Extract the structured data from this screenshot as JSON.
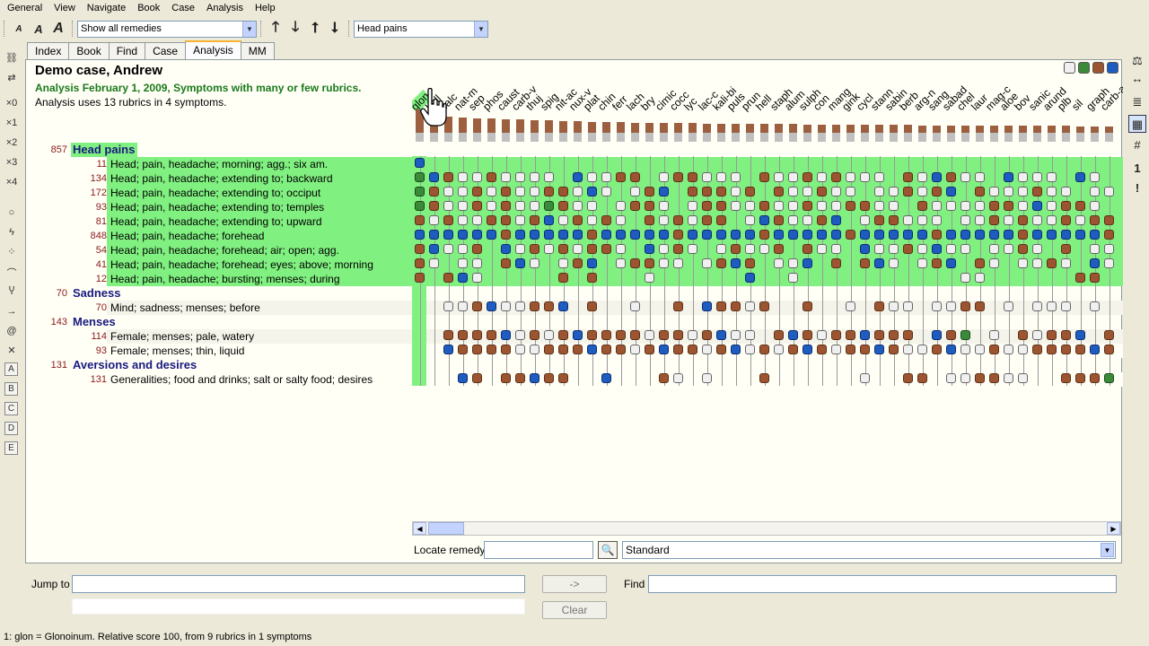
{
  "menu": [
    "General",
    "View",
    "Navigate",
    "Book",
    "Case",
    "Analysis",
    "Help"
  ],
  "toolbar": {
    "remedy_filter": "Show all remedies",
    "symptom_filter": "Head pains"
  },
  "tabs": [
    "Index",
    "Book",
    "Find",
    "Case",
    "Analysis",
    "MM"
  ],
  "active_tab": "Analysis",
  "left_icons": [
    "link-icon",
    "unlink-icon",
    "x0",
    "x1",
    "x2",
    "x3",
    "x4",
    "circle-icon",
    "lightning-icon",
    "dots-icon",
    "arc-icon",
    "fork-icon",
    "arrow-right-icon",
    "spiral-icon",
    "cross-icon",
    "A",
    "B",
    "C",
    "D",
    "E"
  ],
  "left_labels": {
    "x0": "×0",
    "x1": "×1",
    "x2": "×2",
    "x3": "×3",
    "x4": "×4"
  },
  "right_icons": [
    "scale-icon",
    "double-arrow-icon",
    "text-lines-icon",
    "grid-dark-icon",
    "grid-icon",
    "one-icon",
    "exclamation-icon"
  ],
  "case": {
    "title": "Demo case, Andrew",
    "analysis_line": "Analysis February 1, 2009, Symptoms with many or few rubrics.",
    "analysis_sub": "Analysis uses 13 rubrics in 4 symptoms."
  },
  "rows": [
    {
      "kind": "symptom",
      "count": "857",
      "label": "Head pains",
      "hl": true
    },
    {
      "kind": "rubric",
      "count": "11",
      "label": "Head; pain, headache; morning; agg.; six am.",
      "green": true
    },
    {
      "kind": "rubric",
      "count": "134",
      "label": "Head; pain, headache; extending to; backward",
      "green": true
    },
    {
      "kind": "rubric",
      "count": "172",
      "label": "Head; pain, headache; extending to; occiput",
      "green": true
    },
    {
      "kind": "rubric",
      "count": "93",
      "label": "Head; pain, headache; extending to; temples",
      "green": true
    },
    {
      "kind": "rubric",
      "count": "81",
      "label": "Head; pain, headache; extending to; upward",
      "green": true
    },
    {
      "kind": "rubric",
      "count": "848",
      "label": "Head; pain, headache; forehead",
      "green": true
    },
    {
      "kind": "rubric",
      "count": "54",
      "label": "Head; pain, headache; forehead; air; open; agg.",
      "green": true
    },
    {
      "kind": "rubric",
      "count": "41",
      "label": "Head; pain, headache; forehead; eyes; above; morning",
      "green": true
    },
    {
      "kind": "rubric",
      "count": "12",
      "label": "Head; pain, headache; bursting; menses; during",
      "green": true
    },
    {
      "kind": "symptom",
      "count": "70",
      "label": "Sadness",
      "hl": false
    },
    {
      "kind": "rubric",
      "count": "70",
      "label": "Mind; sadness; menses; before",
      "green": false
    },
    {
      "kind": "symptom",
      "count": "143",
      "label": "Menses",
      "hl": false
    },
    {
      "kind": "rubric",
      "count": "114",
      "label": "Female; menses; pale, watery",
      "green": false
    },
    {
      "kind": "rubric",
      "count": "93",
      "label": "Female; menses; thin, liquid",
      "green": false
    },
    {
      "kind": "symptom",
      "count": "131",
      "label": "Aversions and desires",
      "hl": false
    },
    {
      "kind": "rubric",
      "count": "131",
      "label": "Generalities; food and drinks; salt or salty food; desires",
      "green": false
    }
  ],
  "remedies": [
    "glon",
    "bell",
    "calc",
    "nat-m",
    "sep",
    "phos",
    "caust",
    "carb-v",
    "thuj",
    "spig",
    "nit-ac",
    "nux-v",
    "plat",
    "chin",
    "ferr",
    "lach",
    "bry",
    "cimic",
    "cocc",
    "lyc",
    "lac-c",
    "kali-bi",
    "puls",
    "prun",
    "hell",
    "staph",
    "alum",
    "sulph",
    "con",
    "mang",
    "gink",
    "cycl",
    "stann",
    "sabin",
    "berb",
    "arg-n",
    "sang",
    "sabad",
    "chel",
    "laur",
    "mag-c",
    "aloe",
    "bov",
    "sanic",
    "arund",
    "plb",
    "sil",
    "graph",
    "carb-an"
  ],
  "remedy_bars": [
    100,
    72,
    70,
    66,
    62,
    60,
    58,
    56,
    54,
    52,
    50,
    50,
    48,
    46,
    46,
    44,
    44,
    44,
    42,
    42,
    40,
    40,
    40,
    38,
    38,
    38,
    38,
    36,
    36,
    36,
    34,
    34,
    34,
    34,
    34,
    32,
    32,
    32,
    32,
    32,
    30,
    30,
    30,
    30,
    30,
    30,
    28,
    28,
    28
  ],
  "grid_rows": [
    "b.................................................w......................b...........w...........................................w",
    "gbbwwbwwww.bwwbb.wbbwww.bwwbwbwww.bwlbww.bwww.bw.wbbw.gbw.bwwwbw.bwbbww.bwbbw.bbwbw.bbw.wbwbbwbwb.bwwbbbwbbw",
    "gbwwbwbwwbbwbw.wbb.bbbwb.bwwbww.wwbwbb.bwwwbww.wwwbww.wwbwbwbwbbw.wwwbwbwbbwb.bwbwwbbww.wwwbwwbwbwb",
    "gbwwbwbwwgbww.wbbw.wbbwwbwwbwwbbww.bwwwwbbwbwbbw.bwwbw.wwbwwwbw.wwbwwbwwbbgwbbww.wbwbb",
    "bwbwwbbwbbwbwbw.bwbwbb.wbbwwbb.wbbwww.wwbwbwwbwbbwww.bwwbwb.bw.wwbwbwwbbbwwbwbww",
    "bbbbbbbbbbbbbbbbbbbbbbbbbbbbbbbbbbbbbbbbbbbbbbbbbbbbbbbbbbbbbbbbbbbbbbbbbbbbbbbbbbbbbbb",
    "bbwwb.bwbwbwbbw.bwbw.wbwwb.bww.bwwbwbww.wwbw.b.wwbwb",
    "bw.ww.bbw.wbb.wbbww.wbbb.wwb.b.bbw.wbb.bw.wwbw.bw",
    "b.bbw.....b.b...w......b..w...........ww......bb"
  ],
  "grid_rows_b": [
    "..wwbbwwbbb.b..w..b.bbbwb..b..w.bww.wwbb.w.www.w..w..wb..w",
    "..bbbbbwbwbbbbbbwbbwbbww.bbbwbbbbbb.bbg.w.bwbbb.b",
    "..bbbbbwwbbbbbbwbbbbwbbwbwbbbwbbbbwwbbwwbwwbbbbbbb",
    "...bb.bbbbb..b...bw.w...b......w..bb.wwbbww..bbbgbbw"
  ],
  "locate": {
    "label": "Locate remedy",
    "standard": "Standard"
  },
  "bottom": {
    "jump_label": "Jump to",
    "go_button": "->",
    "clear_button": "Clear",
    "find_label": "Find"
  },
  "status": "1: glon = Glonoinum. Relative score 100, from 9 rubrics in 1 symptoms"
}
